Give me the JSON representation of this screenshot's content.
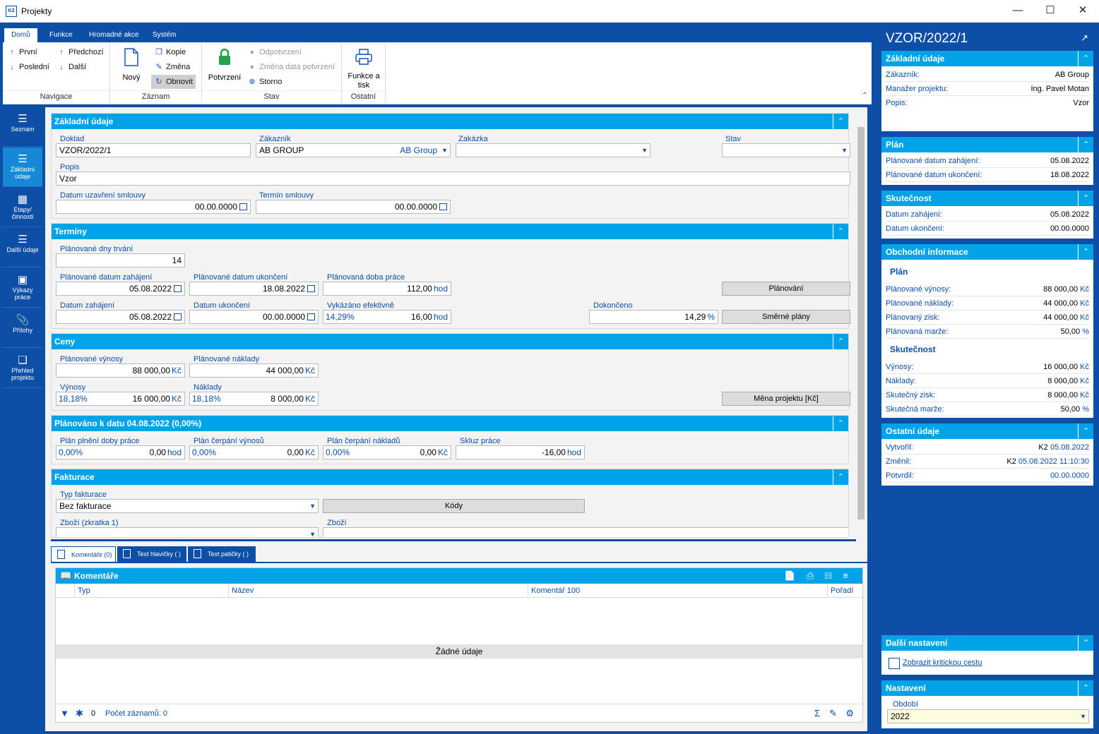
{
  "window": {
    "title": "Projekty",
    "logo": "K2"
  },
  "ribbon": {
    "tabs": [
      "Domů",
      "Funkce",
      "Hromadné akce",
      "Systém"
    ],
    "navigace": {
      "label": "Navigace",
      "prvni": "První",
      "posledni": "Poslední",
      "predchozi": "Předchozí",
      "dalsi": "Další"
    },
    "zaznam": {
      "label": "Záznam",
      "novy": "Nový",
      "kopie": "Kopie",
      "zmena": "Změna",
      "obnovit": "Obnovit"
    },
    "stav": {
      "label": "Stav",
      "potvrzeni": "Potvrzení",
      "odpotvrzeni": "Odpotvrzení",
      "zmena_data": "Změna data potvrzení",
      "storno": "Storno"
    },
    "ostatni": {
      "label": "Ostatní",
      "funkce1": "Funkce a",
      "funkce2": "tisk"
    }
  },
  "leftnav": [
    {
      "label1": "Seznam",
      "label2": ""
    },
    {
      "label1": "Základní",
      "label2": "údaje"
    },
    {
      "label1": "Etapy/",
      "label2": "činnosti"
    },
    {
      "label1": "Další údaje",
      "label2": ""
    },
    {
      "label1": "Výkazy",
      "label2": "práce"
    },
    {
      "label1": "Přílohy",
      "label2": ""
    },
    {
      "label1": "Přehled",
      "label2": "projektu"
    }
  ],
  "zakladni": {
    "title": "Základní údaje",
    "doklad_label": "Doklad",
    "doklad": "VZOR/2022/1",
    "zakaznik_label": "Zákazník",
    "zakaznik": "AB GROUP",
    "zakaznik_name": "AB Group",
    "zakazka_label": "Zakázka",
    "zakazka": "",
    "stav_label": "Stav",
    "stav": "",
    "popis_label": "Popis",
    "popis": "Vzor",
    "datum_uzavreni_label": "Datum uzavření smlouvy",
    "datum_uzavreni": "00.00.0000",
    "termin_label": "Termín smlouvy",
    "termin": "00.00.0000"
  },
  "terminy": {
    "title": "Termíny",
    "dny_label": "Plánované dny trvání",
    "dny": "14",
    "pl_zahajeni_label": "Plánované datum zahájení",
    "pl_zahajeni": "05.08.2022",
    "pl_ukonceni_label": "Plánované datum ukončení",
    "pl_ukonceni": "18.08.2022",
    "pl_doba_label": "Plánovaná doba práce",
    "pl_doba": "112,00",
    "unit_hod": "hod",
    "planovani_btn": "Plánování",
    "zahajeni_label": "Datum zahájení",
    "zahajeni": "05.08.2022",
    "ukonceni_label": "Datum ukončení",
    "ukonceni": "00.00.0000",
    "vykazano_label": "Vykázáno efektivně",
    "vykazano_pct": "14,29%",
    "vykazano": "16,00",
    "dokonceno_label": "Dokončeno",
    "dokonceno": "14,29",
    "unit_pct": "%",
    "smerne_btn": "Směrné plány"
  },
  "ceny": {
    "title": "Ceny",
    "pl_vynosy_label": "Plánované výnosy",
    "pl_vynosy": "88 000,00",
    "pl_naklady_label": "Plánované náklady",
    "pl_naklady": "44 000,00",
    "unit_kc": "Kč",
    "vynosy_label": "Výnosy",
    "vynosy_pct": "18,18%",
    "vynosy": "16 000,00",
    "naklady_label": "Náklady",
    "naklady_pct": "18,18%",
    "naklady": "8 000,00",
    "mena_btn": "Měna projektu [Kč]"
  },
  "planovano": {
    "title": "Plánováno k datu 04.08.2022 (0,00%)",
    "plneni_label": "Plán plnění doby práce",
    "plneni_pct": "0,00%",
    "plneni": "0,00",
    "cerpani_v_label": "Plán čerpání výnosů",
    "cerpani_v_pct": "0,00%",
    "cerpani_v": "0,00",
    "cerpani_n_label": "Plán čerpání nákladů",
    "cerpani_n_pct": "0,00%",
    "cerpani_n": "0,00",
    "skluz_label": "Skluz práce",
    "skluz": "-16,00"
  },
  "fakturace": {
    "title": "Fakturace",
    "typ_label": "Typ fakturace",
    "typ": "Bez fakturace",
    "kody_btn": "Kódy",
    "zbozi_zkr_label": "Zboží (zkratka 1)",
    "zbozi_label": "Zboží"
  },
  "bottom_tabs": [
    "Komentáře (0)",
    "Text hlavičky ( )",
    "Text patičky ( )"
  ],
  "grid": {
    "title": "Komentáře",
    "columns": [
      "Typ",
      "Název",
      "Komentář 100",
      "Pořadí"
    ],
    "empty": "Žádné údaje",
    "count_badge": "0",
    "count_label": "Počet záznamů: 0"
  },
  "right": {
    "title": "VZOR/2022/1",
    "zakladni": {
      "title": "Základní údaje",
      "rows": [
        {
          "k": "Zákazník:",
          "v": "AB Group"
        },
        {
          "k": "Manažer projektu:",
          "v": "Ing. Pavel Motan"
        },
        {
          "k": "Popis:",
          "v": "Vzor"
        }
      ]
    },
    "plan": {
      "title": "Plán",
      "rows": [
        {
          "k": "Plánované datum zahájení:",
          "v": "05.08.2022"
        },
        {
          "k": "Plánované datum ukončení:",
          "v": "18.08.2022"
        }
      ]
    },
    "skutecnost": {
      "title": "Skutečnost",
      "rows": [
        {
          "k": "Datum zahájení:",
          "v": "05.08.2022"
        },
        {
          "k": "Datum ukončení:",
          "v": "00.00.0000"
        }
      ]
    },
    "obchodni": {
      "title": "Obchodní informace",
      "sub_plan": "Plán",
      "sub_skut": "Skutečnost",
      "plan_rows": [
        {
          "k": "Plánované výnosy:",
          "v": "88 000,00",
          "u": "Kč"
        },
        {
          "k": "Plánované náklady:",
          "v": "44 000,00",
          "u": "Kč"
        },
        {
          "k": "Plánovaný zisk:",
          "v": "44 000,00",
          "u": "Kč"
        },
        {
          "k": "Plánovaná marže:",
          "v": "50,00",
          "u": "%"
        }
      ],
      "skut_rows": [
        {
          "k": "Výnosy:",
          "v": "16 000,00",
          "u": "Kč"
        },
        {
          "k": "Náklady:",
          "v": "8 000,00",
          "u": "Kč"
        },
        {
          "k": "Skutečný zisk:",
          "v": "8 000,00",
          "u": "Kč"
        },
        {
          "k": "Skutečná marže:",
          "v": "50,00",
          "u": "%"
        }
      ]
    },
    "ostatni": {
      "title": "Ostatní údaje",
      "vytvoril_k": "Vytvořil:",
      "vytvoril_u": "K2",
      "vytvoril_d": "05.08.2022",
      "zmenil_k": "Změnil:",
      "zmenil_u": "K2",
      "zmenil_d": "05.08.2022 11:10:30",
      "potvrdil_k": "Potvrdil:",
      "potvrdil_d": "00.00.0000"
    },
    "dalsi": {
      "title": "Další nastavení",
      "checkbox": "Zobrazit kritickou cestu"
    },
    "nastaveni": {
      "title": "Nastavení",
      "obdobi_label": "Období",
      "obdobi": "2022"
    }
  },
  "colors": {
    "frame": "#0d4ea6",
    "header": "#00a2e8",
    "label": "#0a4ea8"
  }
}
